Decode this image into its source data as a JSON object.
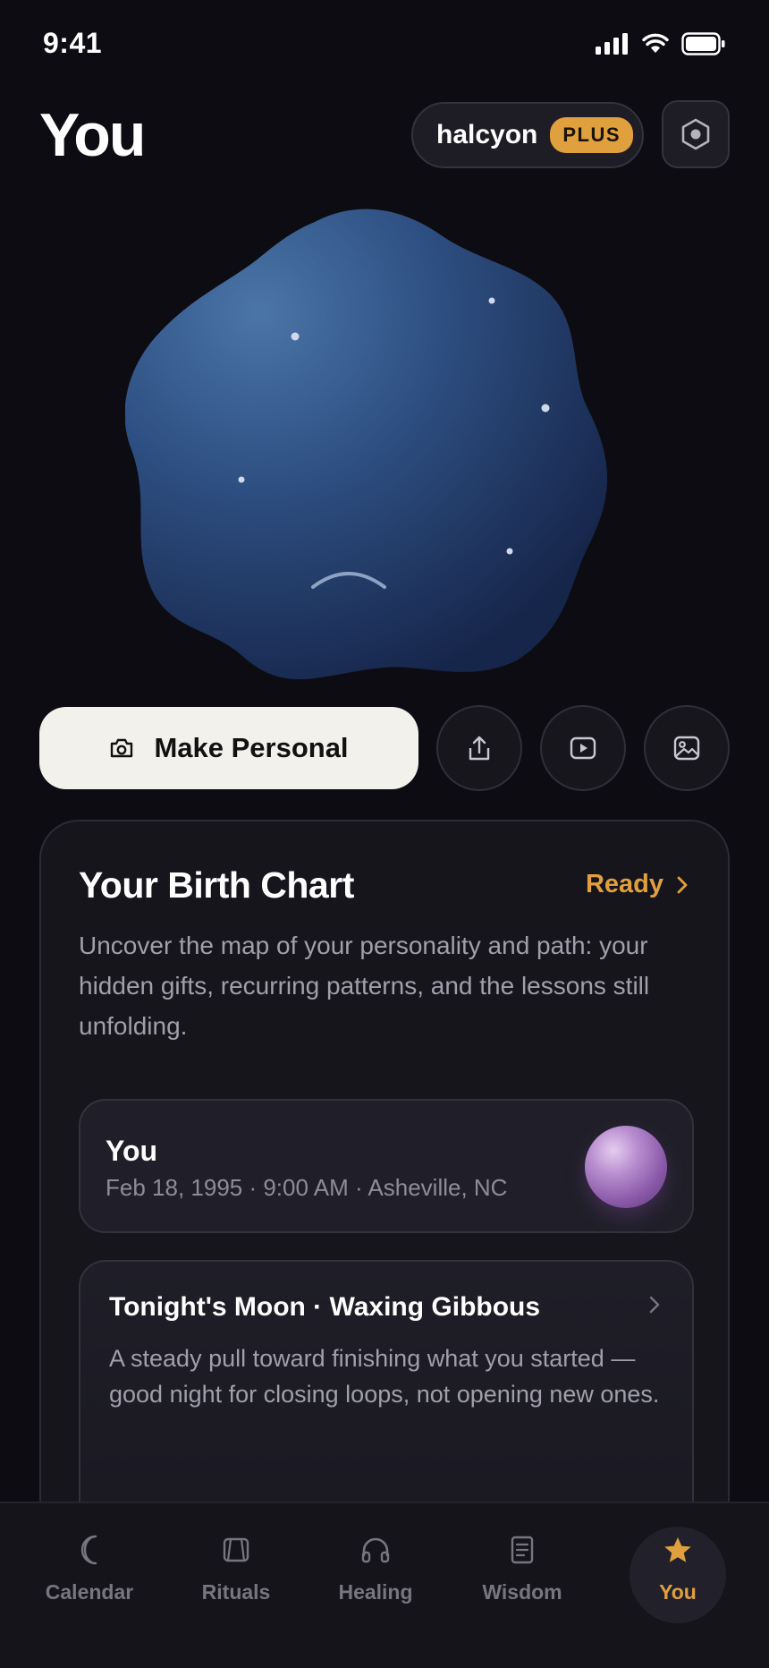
{
  "status_bar": {
    "time": "9:41"
  },
  "header": {
    "title": "You",
    "account_name": "halcyon",
    "plan_badge": "PLUS"
  },
  "actions": {
    "make_personal_label": "Make Personal"
  },
  "birth_chart": {
    "title": "Your Birth Chart",
    "status": "Ready",
    "description": "Uncover the map of your personality and path: your hidden gifts, recurring patterns, and the lessons still unfolding.",
    "profile": {
      "name": "You",
      "details": "Feb 18, 1995 · 9:00 AM · Asheville, NC"
    },
    "moon": {
      "title": "Tonight's Moon · Waxing Gibbous",
      "text": "A steady pull toward finishing what you started — good night for closing loops, not opening new ones."
    }
  },
  "tabs": [
    {
      "label": "Calendar",
      "icon": "crescent-moon-icon",
      "active": false
    },
    {
      "label": "Rituals",
      "icon": "cards-icon",
      "active": false
    },
    {
      "label": "Healing",
      "icon": "headphones-icon",
      "active": false
    },
    {
      "label": "Wisdom",
      "icon": "document-icon",
      "active": false
    },
    {
      "label": "You",
      "icon": "star-icon",
      "active": true
    }
  ],
  "colors": {
    "background": "#0d0c12",
    "accent": "#e0a03e",
    "card": "#16151c",
    "avatar_blue": "#3b5f94"
  }
}
